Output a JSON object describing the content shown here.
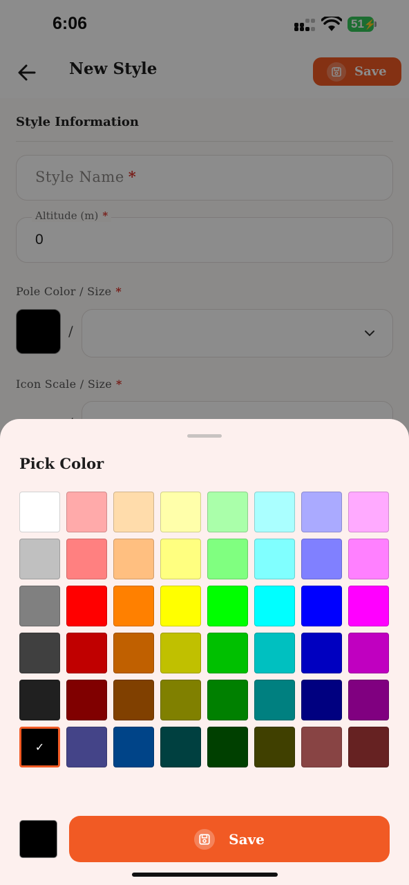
{
  "status_bar": {
    "time": "6:06",
    "battery": "51"
  },
  "app_bar": {
    "title": "New Style",
    "save_label": "Save"
  },
  "form": {
    "section_title": "Style Information",
    "required_mark": "*",
    "style_name_placeholder": "Style Name",
    "altitude_label": "Altitude (m)",
    "altitude_value": "0",
    "pole_label": "Pole Color / Size",
    "pole_color": "#000000",
    "separator": "/",
    "icon_label": "Icon Scale / Size"
  },
  "sheet": {
    "title": "Pick Color",
    "selected_color": "#000000",
    "save_label": "Save",
    "colors": [
      "#ffffff",
      "#ffaaaa",
      "#ffdcab",
      "#ffffaa",
      "#aaffaa",
      "#aaffff",
      "#aaaaff",
      "#ffaaff",
      "#c0c0c0",
      "#ff8080",
      "#ffbf80",
      "#ffff80",
      "#80ff80",
      "#80ffff",
      "#8080ff",
      "#ff80ff",
      "#808080",
      "#ff0000",
      "#ff8000",
      "#ffff00",
      "#00ff00",
      "#00ffff",
      "#0000ff",
      "#ff00ff",
      "#404040",
      "#c00000",
      "#c06000",
      "#c0c000",
      "#00c000",
      "#00c0c0",
      "#0000c0",
      "#c000c0",
      "#202020",
      "#800000",
      "#804000",
      "#808000",
      "#008000",
      "#008080",
      "#000080",
      "#800080",
      "#000000",
      "#444488",
      "#004488",
      "#004040",
      "#004000",
      "#404000",
      "#884444",
      "#662222"
    ],
    "selected_index": 40
  },
  "theme": {
    "accent": "#f15a24"
  }
}
